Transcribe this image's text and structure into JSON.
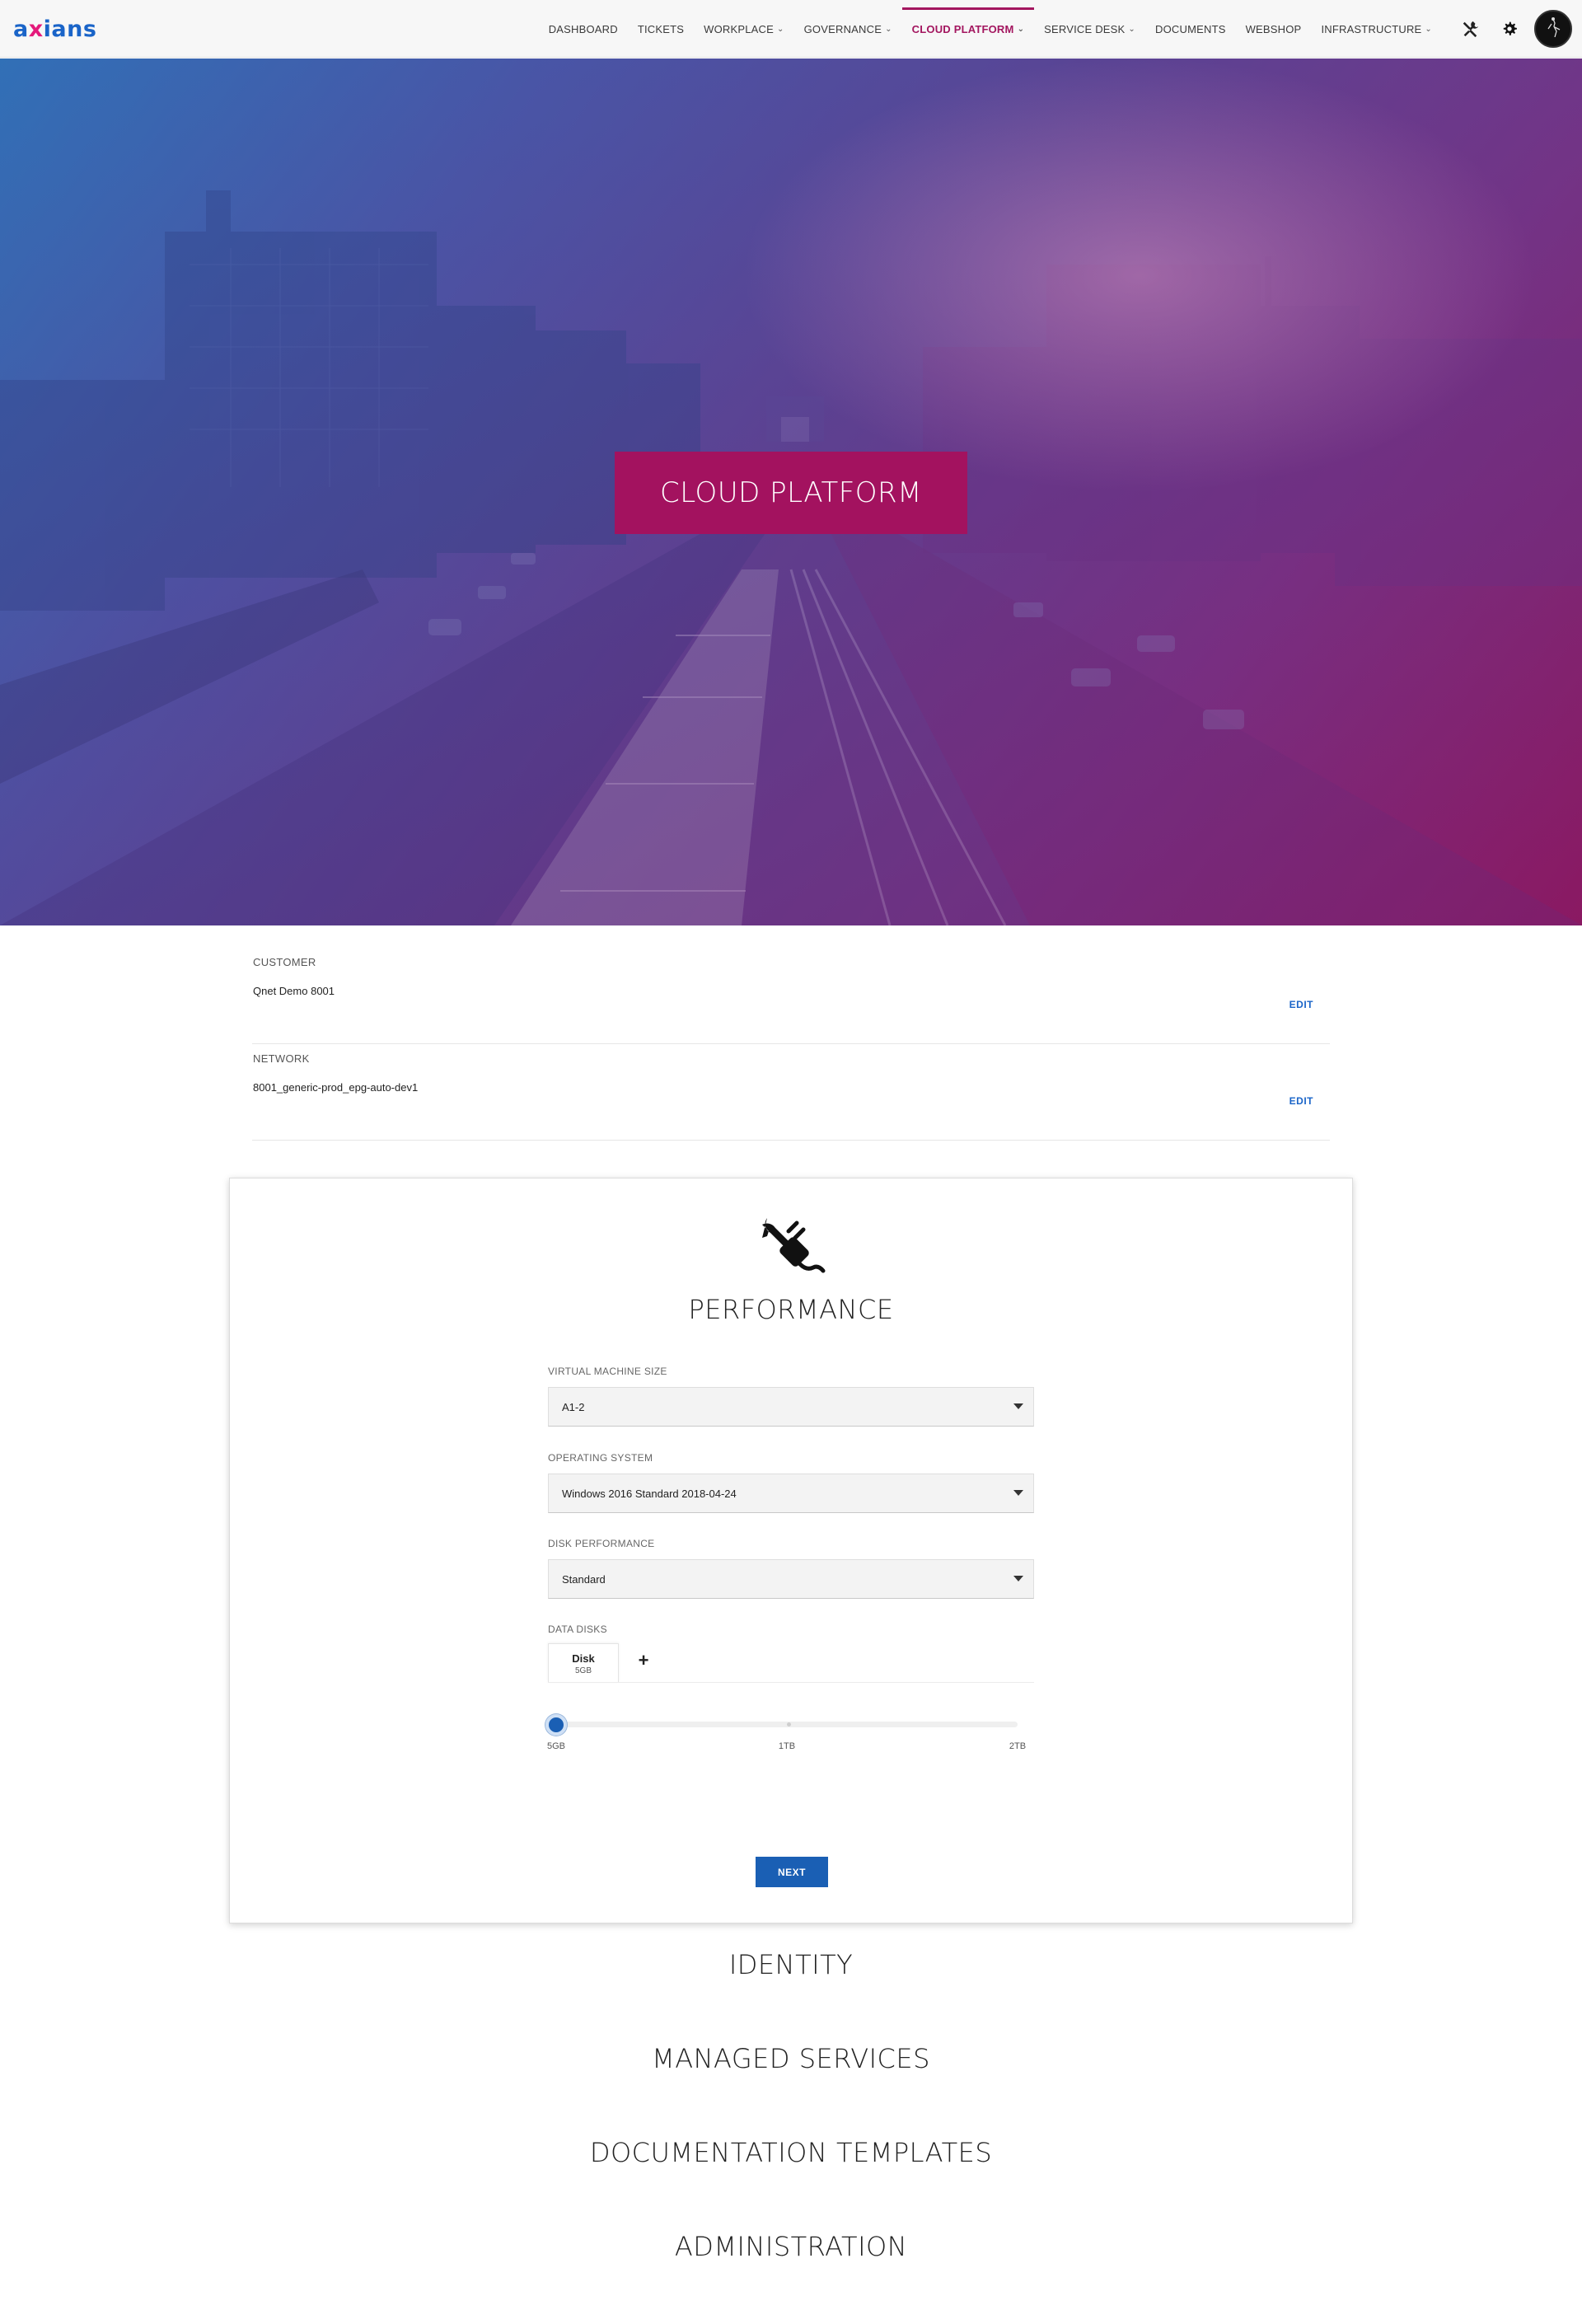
{
  "nav": {
    "logo": "axians",
    "items": [
      {
        "label": "DASHBOARD",
        "dropdown": false,
        "active": false
      },
      {
        "label": "TICKETS",
        "dropdown": false,
        "active": false
      },
      {
        "label": "WORKPLACE",
        "dropdown": true,
        "active": false
      },
      {
        "label": "GOVERNANCE",
        "dropdown": true,
        "active": false
      },
      {
        "label": "CLOUD PLATFORM",
        "dropdown": true,
        "active": true
      },
      {
        "label": "SERVICE DESK",
        "dropdown": true,
        "active": false
      },
      {
        "label": "DOCUMENTS",
        "dropdown": false,
        "active": false
      },
      {
        "label": "WEBSHOP",
        "dropdown": false,
        "active": false
      },
      {
        "label": "INFRASTRUCTURE",
        "dropdown": true,
        "active": false
      }
    ],
    "tools": [
      "tools-icon",
      "gear-icon",
      "avatar"
    ]
  },
  "hero": {
    "title": "CLOUD PLATFORM"
  },
  "info": {
    "customer": {
      "label": "CUSTOMER",
      "value": "Qnet Demo 8001",
      "edit": "EDIT"
    },
    "network": {
      "label": "NETWORK",
      "value": "8001_generic-prod_epg-auto-dev1",
      "edit": "EDIT"
    }
  },
  "performance": {
    "icon": "plug-wrench-icon",
    "title": "PERFORMANCE",
    "vm_size": {
      "label": "VIRTUAL MACHINE SIZE",
      "value": "A1-2"
    },
    "os": {
      "label": "OPERATING SYSTEM",
      "value": "Windows 2016 Standard 2018-04-24"
    },
    "disk_perf": {
      "label": "DISK PERFORMANCE",
      "value": "Standard"
    },
    "data_disks": {
      "label": "DATA DISKS",
      "tabs": [
        {
          "name": "Disk",
          "size": "5GB"
        }
      ],
      "add": "+"
    },
    "slider": {
      "min_label": "5GB",
      "mid_label": "1TB",
      "max_label": "2TB",
      "value_fraction": 0.0
    },
    "next": "NEXT"
  },
  "sections": [
    {
      "title": "IDENTITY"
    },
    {
      "title": "MANAGED SERVICES"
    },
    {
      "title": "DOCUMENTATION TEMPLATES"
    },
    {
      "title": "ADMINISTRATION"
    }
  ],
  "colors": {
    "brand_blue": "#1a64c8",
    "brand_magenta": "#a3125f",
    "hero_gradient_start": "#2f6fb7",
    "hero_gradient_end": "#8a1a63"
  }
}
